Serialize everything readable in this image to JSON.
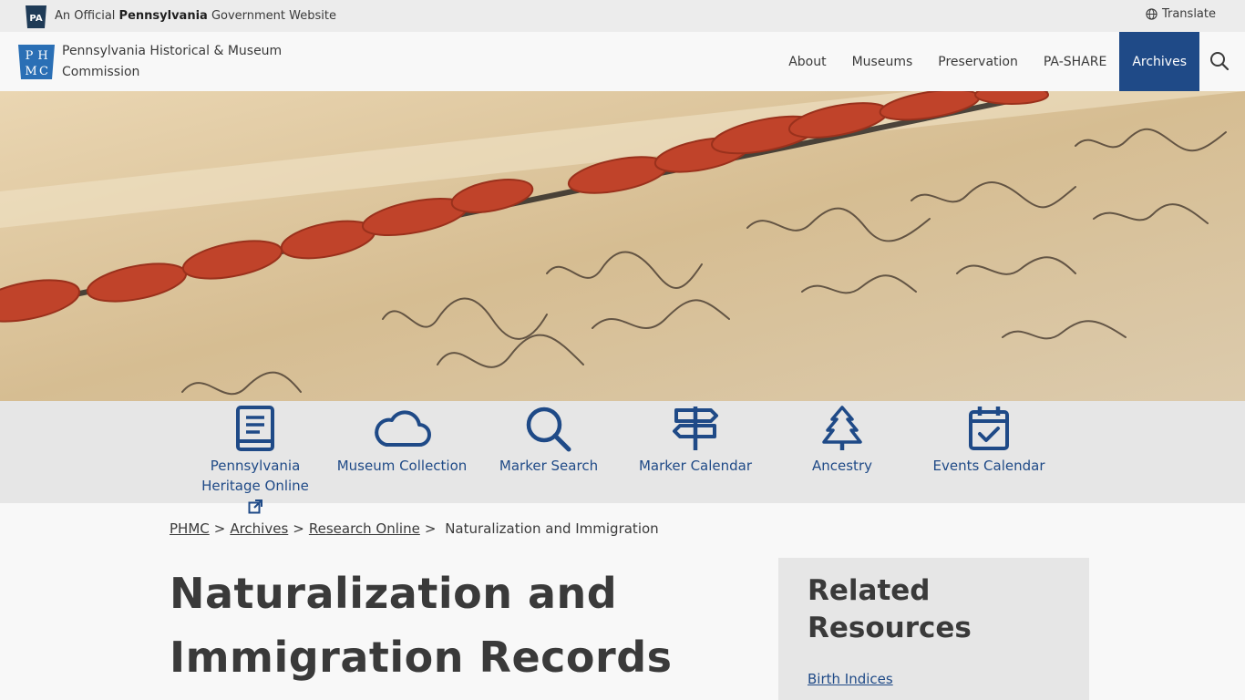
{
  "gov_bar": {
    "badge_text": "PA",
    "prefix": "An Official ",
    "state": "Pennsylvania",
    "suffix": " Government Website",
    "translate_label": "Translate"
  },
  "header": {
    "logo_letters": [
      "P",
      "H",
      "M",
      "C"
    ],
    "site_name": "Pennsylvania Historical & Museum Commission",
    "nav": [
      {
        "label": "About"
      },
      {
        "label": "Museums"
      },
      {
        "label": "Preservation"
      },
      {
        "label": "PA-SHARE"
      },
      {
        "label": "Archives"
      }
    ]
  },
  "quick_links": [
    {
      "label": "Pennsylvania Heritage Online",
      "icon": "book-icon"
    },
    {
      "label": "Museum Collection",
      "icon": "cloud-icon"
    },
    {
      "label": "Marker Search",
      "icon": "magnifier-icon"
    },
    {
      "label": "Marker Calendar",
      "icon": "signpost-icon"
    },
    {
      "label": "Ancestry",
      "icon": "tree-icon"
    },
    {
      "label": "Events Calendar",
      "icon": "calendar-check-icon"
    }
  ],
  "breadcrumb": {
    "items": [
      "PHMC",
      "Archives",
      "Research Online"
    ],
    "current": "Naturalization and Immigration"
  },
  "page": {
    "title": "Naturalization and Immigration Records"
  },
  "related": {
    "title": "Related Resources",
    "links": [
      "Birth Indices"
    ]
  },
  "colors": {
    "brand_blue": "#1f4a87",
    "seal_red": "#c0432a"
  }
}
